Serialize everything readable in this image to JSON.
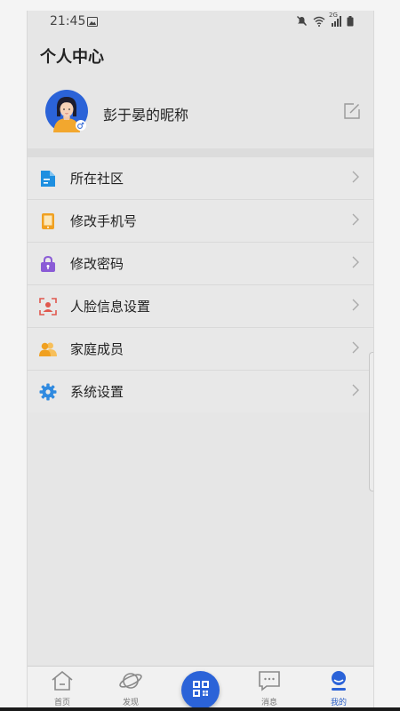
{
  "status_bar": {
    "time": "21:45",
    "network": "2G"
  },
  "page": {
    "title": "个人中心"
  },
  "profile": {
    "nickname": "彭于晏的昵称"
  },
  "menu": {
    "items": [
      {
        "label": "所在社区",
        "icon": "community-document-icon",
        "color": "#1e8fe0"
      },
      {
        "label": "修改手机号",
        "icon": "mobile-phone-icon",
        "color": "#f0a020"
      },
      {
        "label": "修改密码",
        "icon": "lock-icon",
        "color": "#8a5bd6"
      },
      {
        "label": "人脸信息设置",
        "icon": "face-scan-icon",
        "color": "#e0584e"
      },
      {
        "label": "家庭成员",
        "icon": "family-members-icon",
        "color": "#f0a020"
      },
      {
        "label": "系统设置",
        "icon": "gear-icon",
        "color": "#2f8ae0"
      }
    ]
  },
  "tabbar": {
    "tabs": [
      {
        "label": "首页",
        "icon": "home-icon"
      },
      {
        "label": "发现",
        "icon": "planet-icon"
      },
      {
        "label": "",
        "icon": "qr-scan-icon"
      },
      {
        "label": "消息",
        "icon": "message-icon"
      },
      {
        "label": "我的",
        "icon": "profile-icon",
        "active": true
      }
    ],
    "accent": "#2b63d8"
  }
}
